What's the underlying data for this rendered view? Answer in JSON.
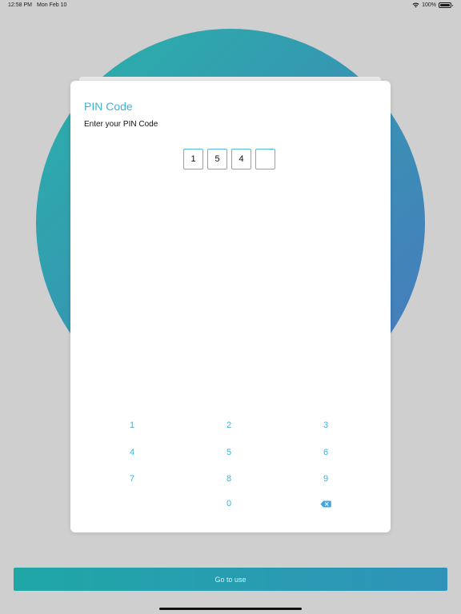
{
  "status_bar": {
    "time": "12:58 PM",
    "date": "Mon Feb 10",
    "battery": "100%",
    "icons": [
      "wifi-icon",
      "battery-icon"
    ]
  },
  "dialog": {
    "title": "PIN Code",
    "subtitle": "Enter your PIN Code",
    "pin_digits": [
      "1",
      "5",
      "4",
      ""
    ]
  },
  "keypad": {
    "keys": [
      "1",
      "2",
      "3",
      "4",
      "5",
      "6",
      "7",
      "8",
      "9",
      "0"
    ],
    "backspace_icon": "backspace-icon"
  },
  "footer": {
    "button_label": "Go to use"
  },
  "colors": {
    "accent": "#3fb2d8",
    "background": "#cfcfcf",
    "circle_start": "#1ab0a6",
    "circle_end": "#3f6fbf"
  }
}
